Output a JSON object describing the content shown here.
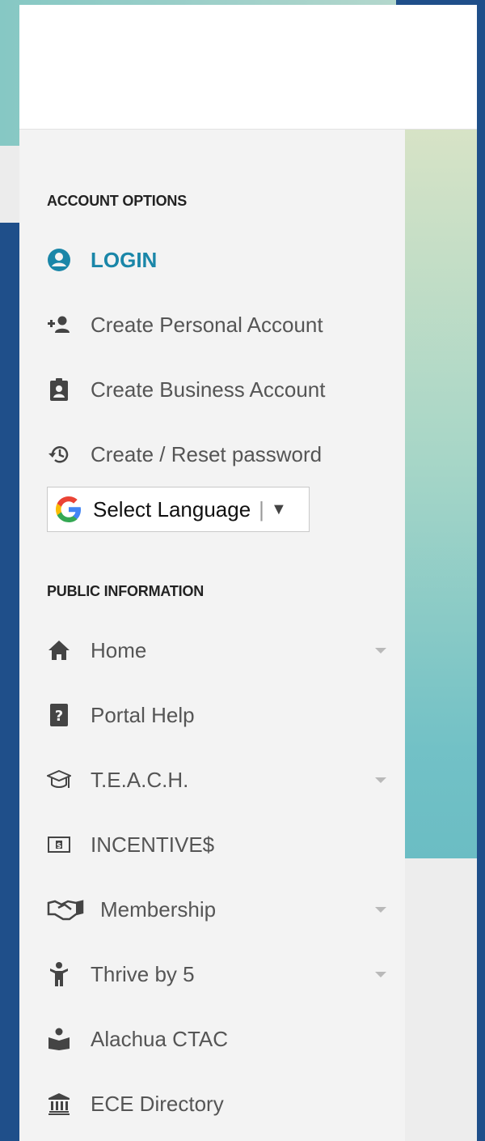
{
  "sections": {
    "account": {
      "title": "ACCOUNT OPTIONS",
      "items": [
        {
          "label": "LOGIN"
        },
        {
          "label": "Create Personal Account"
        },
        {
          "label": "Create Business Account"
        },
        {
          "label": "Create / Reset password"
        }
      ]
    },
    "language": {
      "label": "Select Language",
      "separator": "|",
      "arrow": "▼"
    },
    "public": {
      "title": "PUBLIC INFORMATION",
      "items": [
        {
          "label": "Home"
        },
        {
          "label": "Portal Help"
        },
        {
          "label": "T.E.A.C.H."
        },
        {
          "label": "INCENTIVE$"
        },
        {
          "label": "Membership"
        },
        {
          "label": "Thrive by 5"
        },
        {
          "label": "Alachua CTAC"
        },
        {
          "label": "ECE Directory"
        }
      ]
    }
  },
  "colors": {
    "accent": "#1a86a8",
    "sidebar_bg": "#f3f3f3",
    "page_bg": "#1f4f8a"
  }
}
